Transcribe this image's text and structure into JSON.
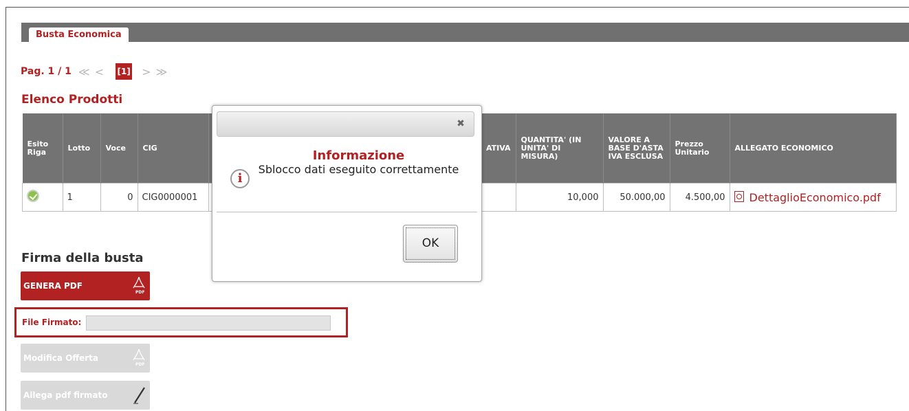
{
  "tab": {
    "label": "Busta Economica"
  },
  "pager": {
    "label": "Pag. 1 / 1",
    "first_prev": "≪ <",
    "current": "[1]",
    "next_last": "> ≫"
  },
  "section": {
    "title": "Elenco Prodotti"
  },
  "table": {
    "headers": {
      "esito": "Esito Riga",
      "lotto": "Lotto",
      "voce": "Voce",
      "cig": "CIG",
      "ativa": "ATIVA",
      "quantita": "QUANTITA' (IN UNITA' DI MISURA)",
      "valore": "VALORE A BASE D'ASTA IVA ESCLUSA",
      "prezzo": "Prezzo Unitario",
      "allegato": "ALLEGATO ECONOMICO"
    },
    "row": {
      "esito_icon": "check-circle-icon",
      "lotto": "1",
      "voce": "0",
      "cig": "CIG0000001",
      "quantita": "10,000",
      "valore": "50.000,00",
      "prezzo": "4.500,00",
      "allegato": "DettaglioEconomico.pdf"
    }
  },
  "firma": {
    "title": "Firma della busta",
    "genera_pdf": "GENERA PDF",
    "file_firmato_label": "File Firmato:",
    "modifica_offerta": "Modifica Offerta",
    "allega_pdf": "Allega pdf firmato"
  },
  "modal": {
    "title": "Informazione",
    "message": "Sblocco dati eseguito correttamente",
    "ok": "OK",
    "close": "✖"
  },
  "colors": {
    "brand": "#b22222",
    "header": "#737373"
  }
}
